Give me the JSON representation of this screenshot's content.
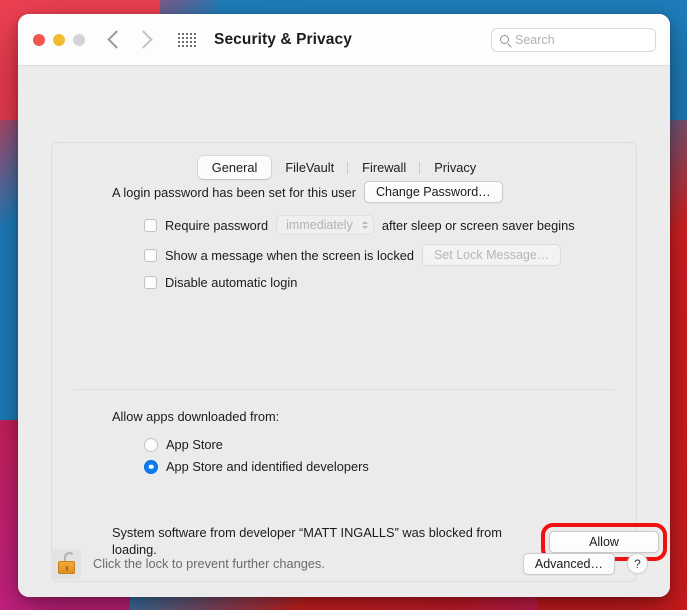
{
  "window": {
    "title": "Security & Privacy",
    "traffic_lights": {
      "close": "close-button",
      "minimize": "minimize-button",
      "zoom": "zoom-button"
    },
    "nav": {
      "back": "back-arrow",
      "forward": "forward-arrow",
      "grid": "show-all-grid"
    },
    "search": {
      "placeholder": "Search"
    }
  },
  "tabs": [
    {
      "label": "General",
      "active": true
    },
    {
      "label": "FileVault",
      "active": false
    },
    {
      "label": "Firewall",
      "active": false
    },
    {
      "label": "Privacy",
      "active": false
    }
  ],
  "general": {
    "login_password_text": "A login password has been set for this user",
    "change_password_button": "Change Password…",
    "require_password": {
      "label_before": "Require password",
      "popup_value": "immediately",
      "label_after": "after sleep or screen saver begins",
      "checked": false,
      "popup_disabled": true
    },
    "show_message": {
      "label": "Show a message when the screen is locked",
      "button": "Set Lock Message…",
      "checked": false,
      "button_disabled": true
    },
    "disable_auto_login": {
      "label": "Disable automatic login",
      "checked": false
    }
  },
  "gatekeeper": {
    "section_label": "Allow apps downloaded from:",
    "options": [
      {
        "label": "App Store",
        "selected": false
      },
      {
        "label": "App Store and identified developers",
        "selected": true
      }
    ]
  },
  "blocked_notice": {
    "message": "System software from developer “MATT INGALLS” was blocked from loading.",
    "allow_button": "Allow",
    "highlight_color": "#ef1111"
  },
  "footer": {
    "lock_text": "Click the lock to prevent further changes.",
    "lock_state": "unlocked",
    "advanced_button": "Advanced…",
    "help_button": "?"
  },
  "colors": {
    "accent_blue": "#0a7cf3",
    "highlight_red": "#ef1111",
    "lock_gold": "#e08f22",
    "window_bg": "#ececec"
  }
}
